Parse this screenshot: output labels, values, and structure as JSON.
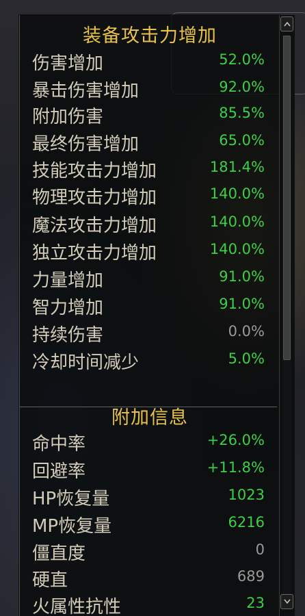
{
  "equipment_attack": {
    "title": "装备攻击力增加",
    "stats": [
      {
        "label": "伤害增加",
        "value": "52.0%"
      },
      {
        "label": "暴击伤害增加",
        "value": "92.0%"
      },
      {
        "label": "附加伤害",
        "value": "85.5%"
      },
      {
        "label": "最终伤害增加",
        "value": "65.0%"
      },
      {
        "label": "技能攻击力增加",
        "value": "181.4%"
      },
      {
        "label": "物理攻击力增加",
        "value": "140.0%"
      },
      {
        "label": "魔法攻击力增加",
        "value": "140.0%"
      },
      {
        "label": "独立攻击力增加",
        "value": "140.0%"
      },
      {
        "label": "力量增加",
        "value": "91.0%"
      },
      {
        "label": "智力增加",
        "value": "91.0%"
      },
      {
        "label": "持续伤害",
        "value": "0.0%"
      },
      {
        "label": "冷却时间减少",
        "value": "5.0%"
      }
    ]
  },
  "additional_info": {
    "title": "附加信息",
    "stats": [
      {
        "label": "命中率",
        "value": "+26.0%"
      },
      {
        "label": "回避率",
        "value": "+11.8%"
      },
      {
        "label": "HP恢复量",
        "value": "1023"
      },
      {
        "label": "MP恢复量",
        "value": "6216"
      },
      {
        "label": "僵直度",
        "value": "0"
      },
      {
        "label": "硬直",
        "value": "689"
      },
      {
        "label": "火属性抗性",
        "value": "23"
      }
    ]
  },
  "colors": {
    "title": "#e8c24a",
    "label": "#d2ccb8",
    "value_positive": "#3ecf45",
    "value_zero": "#9a9a9a"
  },
  "scroll": {
    "position_fraction": 0.0,
    "visible_fraction": 0.58
  },
  "icons": {
    "scroll_up": "chevron-up-icon",
    "scroll_down": "chevron-down-icon"
  }
}
